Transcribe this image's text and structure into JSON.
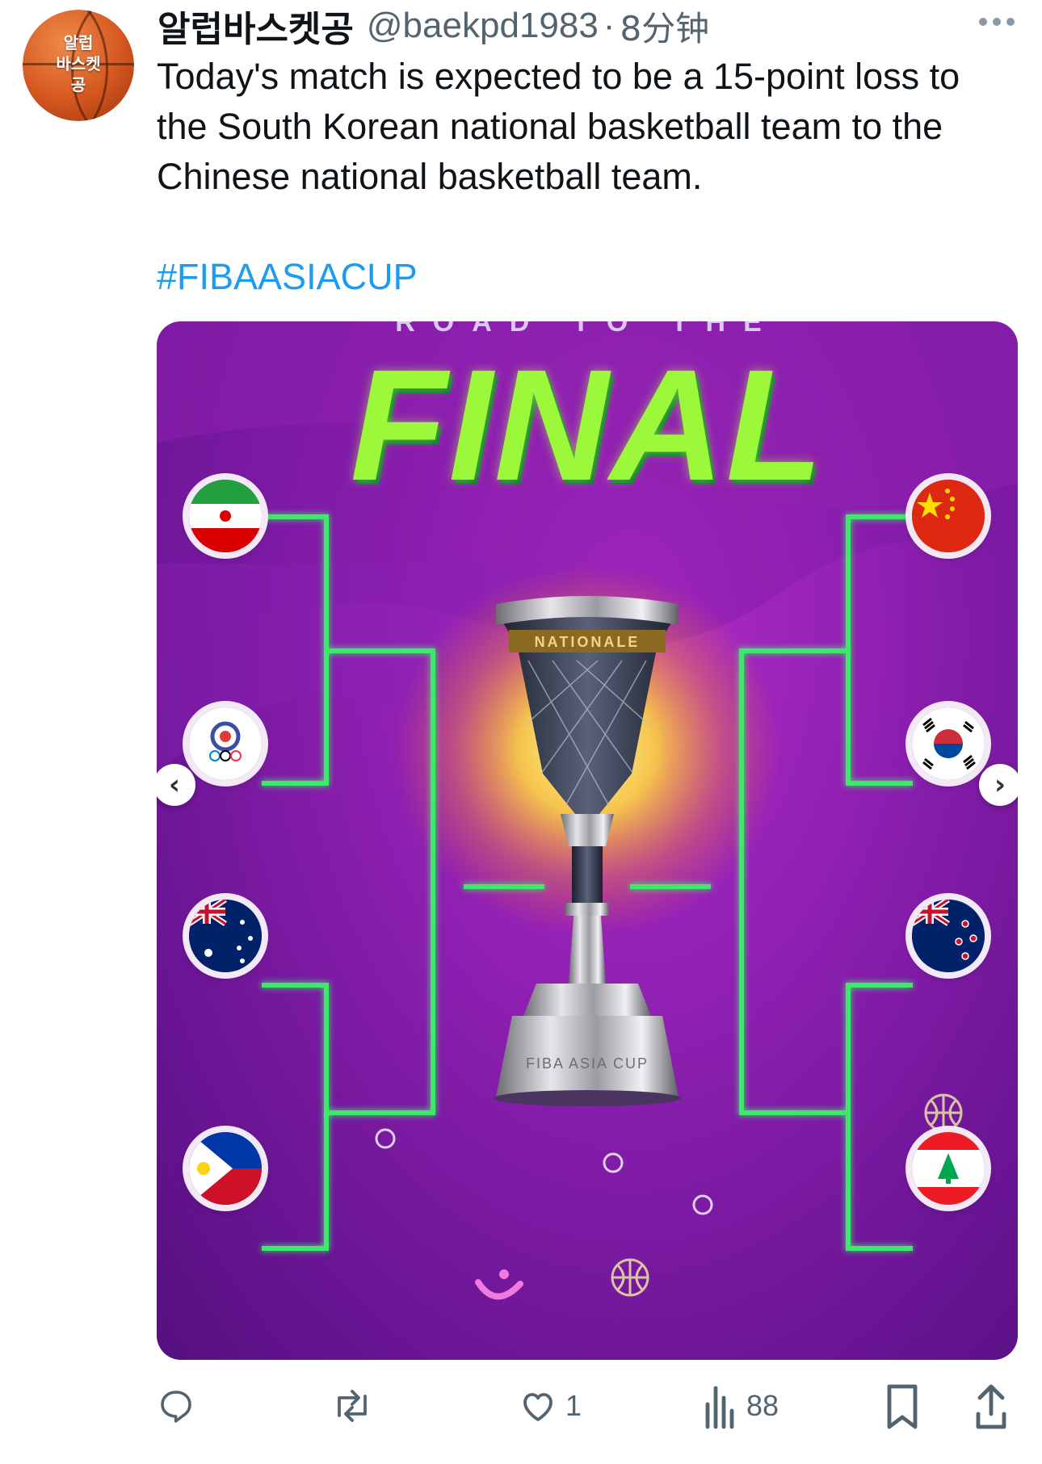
{
  "author": {
    "avatar_text": "알럽\n바스켓\n공",
    "display_name": "알럽바스켓공",
    "handle": "@baekpd1983",
    "separator": "·",
    "time": "8分钟"
  },
  "tweet": {
    "text": "Today's match is expected to be a 15-point loss to the South Korean national basketball team to the Chinese national basketball team.",
    "hashtag": "#FIBAASIACUP"
  },
  "media": {
    "top_text": "ROAD TO THE",
    "title": "FINAL",
    "cup_band_text": "NATIONALE",
    "cup_base_text": "FIBA ASIA CUP",
    "left_flags": [
      "iran-flag-icon",
      "chinese-taipei-flag-icon",
      "australia-flag-icon",
      "philippines-flag-icon"
    ],
    "right_flags": [
      "china-flag-icon",
      "south-korea-flag-icon",
      "new-zealand-flag-icon",
      "lebanon-flag-icon"
    ],
    "accent_color": "#3ee86a"
  },
  "actions": {
    "reply_count": "",
    "retweet_count": "",
    "like_count": "1",
    "views_count": "88"
  }
}
